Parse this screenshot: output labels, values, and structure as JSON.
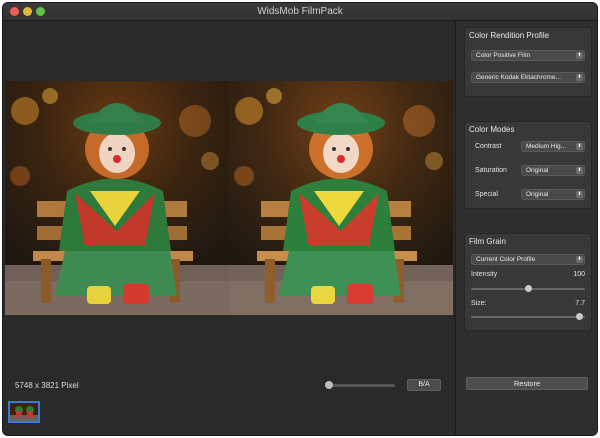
{
  "window": {
    "title": "WidsMob FilmPack"
  },
  "viewer": {
    "dimensions": "5748 x 3821 Pixel",
    "zoom_level": 0.0,
    "before_after_label": "B/A"
  },
  "color_rendition": {
    "title": "Color Rendition Profile",
    "profile_type": "Color Positive Film",
    "profile": "Generic Kodak Ektachrome..."
  },
  "color_modes": {
    "title": "Color Modes",
    "contrast_label": "Contrast",
    "contrast_value": "Medium Hig...",
    "saturation_label": "Saturation",
    "saturation_value": "Original",
    "special_label": "Special",
    "special_value": "Original"
  },
  "film_grain": {
    "title": "Film Grain",
    "profile": "Current Color Profile",
    "intensity_label": "Intensity",
    "intensity_value": "100",
    "intensity_level": 0.5,
    "size_label": "Size:",
    "size_value": "7.7",
    "size_level": 0.98
  },
  "restore_label": "Restore",
  "colors": {
    "window_bg": "#2b2b2b",
    "panel_bg": "#383838",
    "selection_blue": "#3a7bd5"
  }
}
